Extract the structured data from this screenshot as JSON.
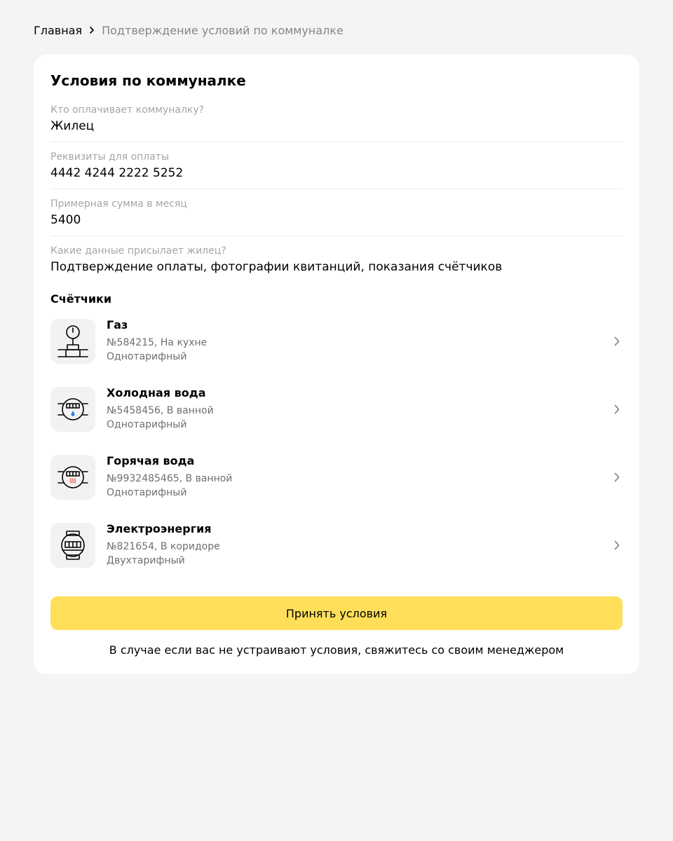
{
  "breadcrumb": {
    "home": "Главная",
    "current": "Подтверждение условий по коммуналке"
  },
  "card": {
    "title": "Условия по коммуналке",
    "fields": [
      {
        "label": "Кто оплачивает коммуналку?",
        "value": "Жилец"
      },
      {
        "label": "Реквизиты для оплаты",
        "value": "4442 4244 2222 5252"
      },
      {
        "label": "Примерная сумма в месяц",
        "value": "5400"
      },
      {
        "label": "Какие данные присылает жилец?",
        "value": "Подтверждение оплаты, фотографии квитанций, показания счётчиков"
      }
    ],
    "meters_title": "Счётчики",
    "meters": [
      {
        "name": "Газ",
        "info": "№584215, На кухне",
        "tariff": "Однотарифный",
        "icon": "gas-meter-icon"
      },
      {
        "name": "Холодная вода",
        "info": "№5458456, В ванной",
        "tariff": "Однотарифный",
        "icon": "cold-water-meter-icon"
      },
      {
        "name": "Горячая вода",
        "info": "№9932485465, В ванной",
        "tariff": "Однотарифный",
        "icon": "hot-water-meter-icon"
      },
      {
        "name": "Электроэнергия",
        "info": "№821654, В коридоре",
        "tariff": "Двухтарифный",
        "icon": "electricity-meter-icon"
      }
    ],
    "accept_label": "Принять условия",
    "footer_note": "В случае если вас не устраивают условия, свяжитесь со своим менеджером"
  },
  "colors": {
    "background": "#f4f4f6",
    "card": "#ffffff",
    "accent_button": "#ffdf5a",
    "muted_text": "#a6a6a6",
    "secondary_text": "#6f6f6f",
    "cold_water_drop": "#2d7fe8",
    "hot_water_waves": "#e8453c"
  }
}
